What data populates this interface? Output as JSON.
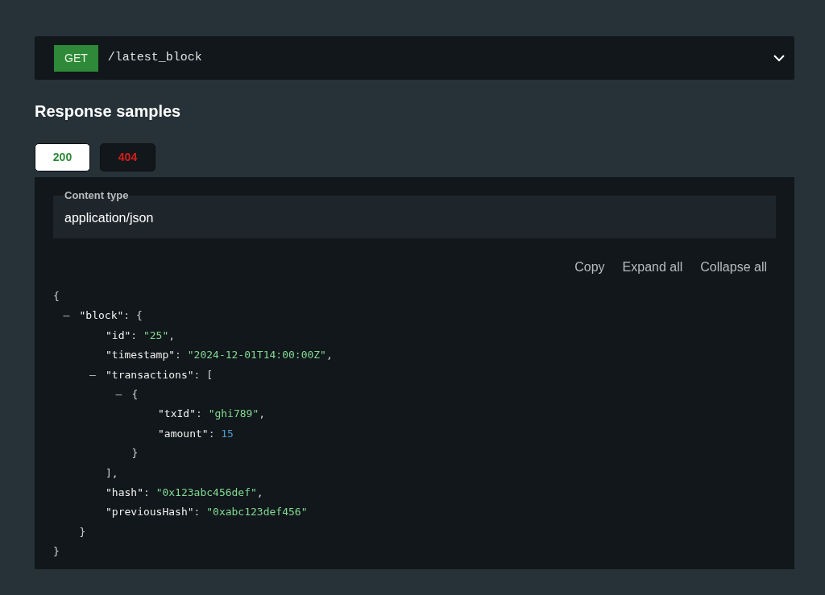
{
  "endpoint": {
    "method": "GET",
    "path": "/latest_block",
    "expanded": true
  },
  "section_title": "Response samples",
  "tabs": [
    {
      "label": "200",
      "kind": "success",
      "selected": true
    },
    {
      "label": "404",
      "kind": "error",
      "selected": false
    }
  ],
  "content_type": {
    "label": "Content type",
    "value": "application/json"
  },
  "actions": [
    "Copy",
    "Expand all",
    "Collapse all"
  ],
  "code": {
    "tokens": [
      {
        "kind": "punct",
        "text": "{"
      }
    ],
    "closing": [
      {
        "kind": "punct",
        "text": "}"
      }
    ],
    "children": [
      {
        "toggle": "–",
        "tokens": [
          {
            "kind": "key",
            "text": "\"block\""
          },
          {
            "kind": "punct",
            "text": ": {"
          }
        ],
        "closing": [
          {
            "kind": "punct",
            "text": "}"
          }
        ],
        "children": [
          {
            "tokens": [
              {
                "kind": "key",
                "text": "\"id\""
              },
              {
                "kind": "punct",
                "text": ": "
              },
              {
                "kind": "string",
                "text": "\"25\""
              },
              {
                "kind": "punct",
                "text": ","
              }
            ]
          },
          {
            "tokens": [
              {
                "kind": "key",
                "text": "\"timestamp\""
              },
              {
                "kind": "punct",
                "text": ": "
              },
              {
                "kind": "string",
                "text": "\"2024-12-01T14:00:00Z\""
              },
              {
                "kind": "punct",
                "text": ","
              }
            ]
          },
          {
            "toggle": "–",
            "tokens": [
              {
                "kind": "key",
                "text": "\"transactions\""
              },
              {
                "kind": "punct",
                "text": ": ["
              }
            ],
            "closing": [
              {
                "kind": "punct",
                "text": "],"
              }
            ],
            "children": [
              {
                "toggle": "–",
                "tokens": [
                  {
                    "kind": "punct",
                    "text": "{"
                  }
                ],
                "closing": [
                  {
                    "kind": "punct",
                    "text": "}"
                  }
                ],
                "children": [
                  {
                    "tokens": [
                      {
                        "kind": "key",
                        "text": "\"txId\""
                      },
                      {
                        "kind": "punct",
                        "text": ": "
                      },
                      {
                        "kind": "string",
                        "text": "\"ghi789\""
                      },
                      {
                        "kind": "punct",
                        "text": ","
                      }
                    ]
                  },
                  {
                    "tokens": [
                      {
                        "kind": "key",
                        "text": "\"amount\""
                      },
                      {
                        "kind": "punct",
                        "text": ": "
                      },
                      {
                        "kind": "number",
                        "text": "15"
                      }
                    ]
                  }
                ]
              }
            ]
          },
          {
            "tokens": [
              {
                "kind": "key",
                "text": "\"hash\""
              },
              {
                "kind": "punct",
                "text": ": "
              },
              {
                "kind": "string",
                "text": "\"0x123abc456def\""
              },
              {
                "kind": "punct",
                "text": ","
              }
            ]
          },
          {
            "tokens": [
              {
                "kind": "key",
                "text": "\"previousHash\""
              },
              {
                "kind": "punct",
                "text": ": "
              },
              {
                "kind": "string",
                "text": "\"0xabc123def456\""
              }
            ]
          }
        ]
      }
    ]
  }
}
